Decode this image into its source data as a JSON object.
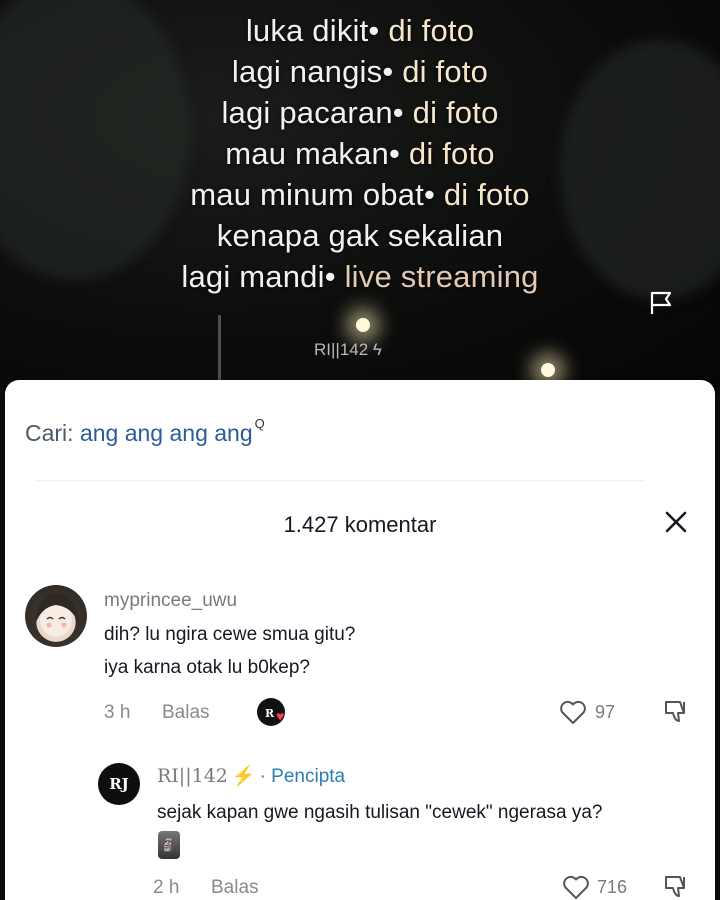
{
  "video": {
    "lyrics": [
      {
        "text": "luka dikit",
        "suffix": "di foto"
      },
      {
        "text": "lagi nangis",
        "suffix": "di foto"
      },
      {
        "text": "lagi pacaran",
        "suffix": "di foto"
      },
      {
        "text": "mau makan",
        "suffix": "di foto"
      },
      {
        "text": "mau minum obat",
        "suffix": "di foto"
      },
      {
        "text": "kenapa gak sekalian",
        "suffix": ""
      },
      {
        "text": "lagi mandi",
        "suffix": "live streaming"
      }
    ],
    "bullet": "•",
    "watermark": "RI||142 ϟ",
    "flag_icon": "flag-icon"
  },
  "comments_panel": {
    "search_prefix": "Cari: ",
    "search_query": "ang ang ang ang",
    "search_icon": "Q",
    "count_label": "1.427 komentar",
    "close_icon": "close-icon",
    "comments": [
      {
        "username": "myprincee_uwu",
        "lines": [
          "dih? lu ngira cewe smua gitu?",
          "iya karna otak lu b0kep?"
        ],
        "time": "3 h",
        "reply_label": "Balas",
        "likes": "97"
      }
    ],
    "reply": {
      "username": "RI||142",
      "bolt": "⚡",
      "creator_tag": "· Pencipta",
      "avatar_text": "RJ",
      "text": "sejak kapan gwe ngasih tulisan \"cewek\" ngerasa ya?",
      "sticker": "🗿",
      "time": "2 h",
      "reply_label": "Balas",
      "likes": "716"
    }
  },
  "colors": {
    "accent_link": "#2a5c9a",
    "creator_tag": "#2a7fb4",
    "heart_pink": "#ff3b5c"
  }
}
